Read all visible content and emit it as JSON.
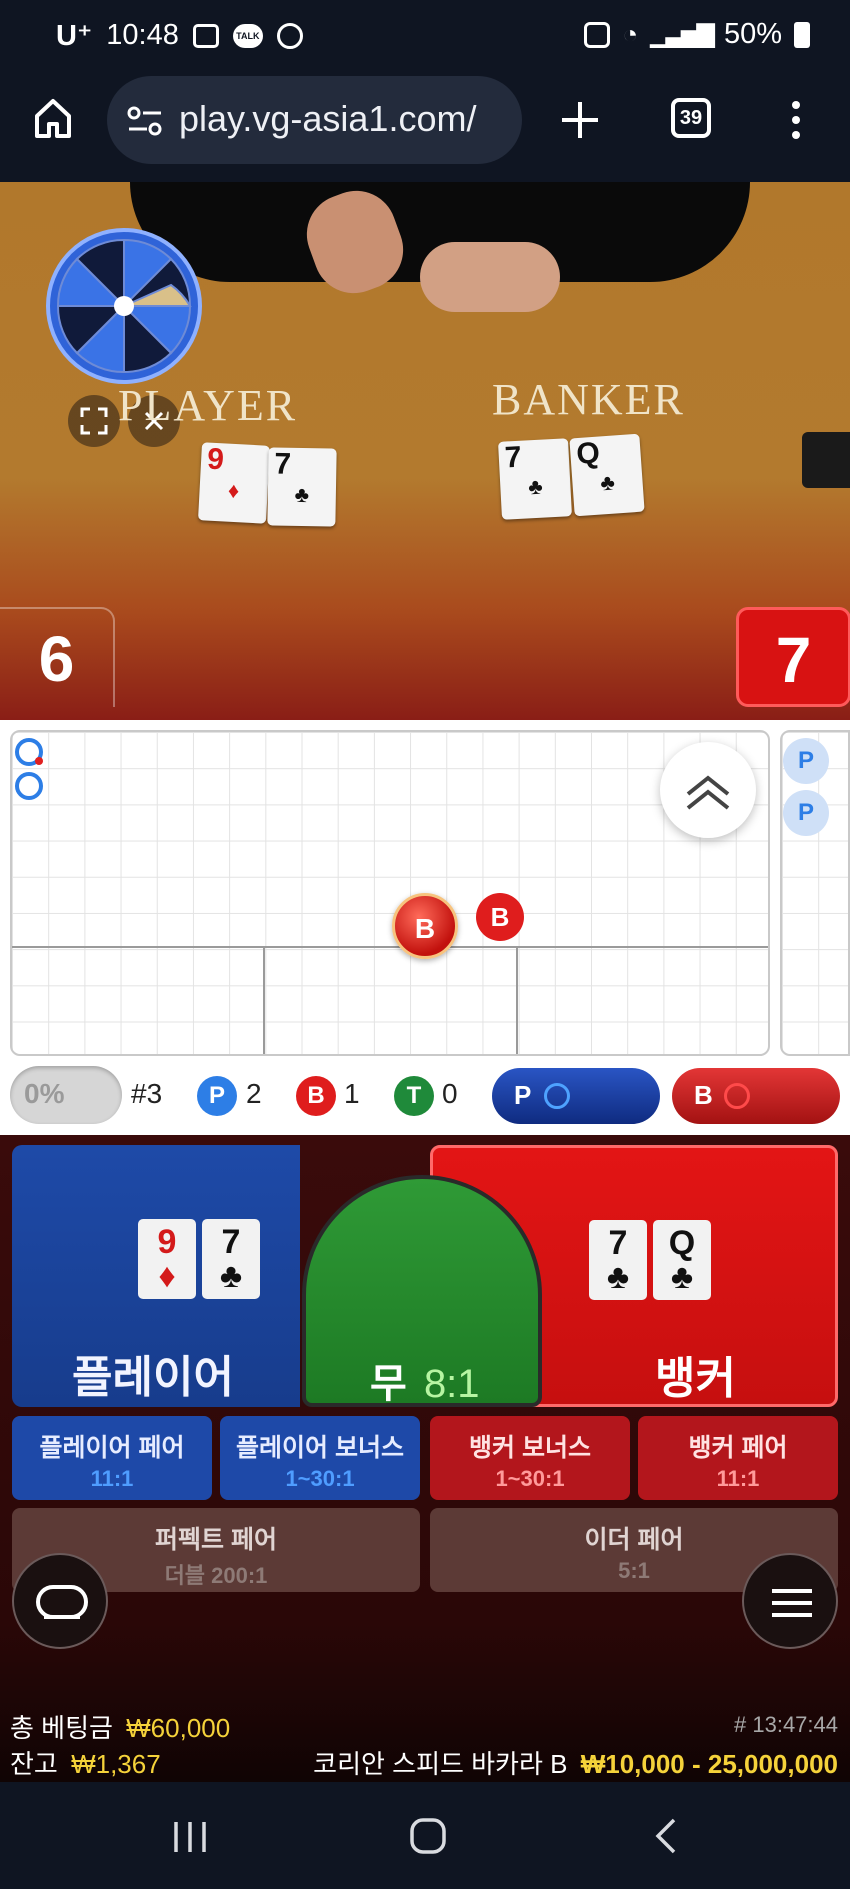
{
  "status_bar": {
    "carrier": "U⁺",
    "time": "10:48",
    "battery": "50%"
  },
  "browser": {
    "url": "play.vg-asia1.com/",
    "tab_count": "39"
  },
  "video": {
    "player_label": "PLAYER",
    "banker_label": "BANKER",
    "player_cards": [
      {
        "rank": "9",
        "suit": "♦",
        "color": "red"
      },
      {
        "rank": "7",
        "suit": "♣",
        "color": "black"
      }
    ],
    "banker_cards": [
      {
        "rank": "7",
        "suit": "♣",
        "color": "black"
      },
      {
        "rank": "Q",
        "suit": "♣",
        "color": "black"
      }
    ],
    "player_score": "6",
    "banker_score": "7"
  },
  "roadmap": {
    "big_ball_label": "B",
    "small_ball_label": "B",
    "side_labels": [
      "P",
      "P"
    ]
  },
  "stats": {
    "percent": "0%",
    "round": "#3",
    "player_badge": "P",
    "player_count": "2",
    "banker_badge": "B",
    "banker_count": "1",
    "tie_badge": "T",
    "tie_count": "0",
    "player_predict": "P",
    "banker_predict": "B"
  },
  "bets": {
    "player": {
      "label": "플레이어",
      "cards": [
        {
          "rank": "9",
          "suit": "♦",
          "color": "red"
        },
        {
          "rank": "7",
          "suit": "♣",
          "color": "black"
        }
      ]
    },
    "tie": {
      "label": "무",
      "odds": "8:1"
    },
    "banker": {
      "label": "뱅커",
      "cards": [
        {
          "rank": "7",
          "suit": "♣",
          "color": "black"
        },
        {
          "rank": "Q",
          "suit": "♣",
          "color": "black"
        }
      ]
    },
    "player_pair": {
      "label": "플레이어 페어",
      "odds": "11:1"
    },
    "player_bonus": {
      "label": "플레이어 보너스",
      "odds": "1~30:1"
    },
    "banker_bonus": {
      "label": "뱅커 보너스",
      "odds": "1~30:1"
    },
    "banker_pair": {
      "label": "뱅커 페어",
      "odds": "11:1"
    },
    "perfect_pair": {
      "label": "퍼펙트 페어",
      "odds": "더블 200:1"
    },
    "either_pair": {
      "label": "이더 페어",
      "odds": "5:1"
    }
  },
  "footer": {
    "total_bet_label": "총 베팅금",
    "total_bet_value": "₩60,000",
    "balance_label": "잔고",
    "balance_value": "₩1,367",
    "game_id": "# 13:47:44",
    "table_name": "코리안 스피드 바카라 B",
    "limits": "₩10,000 - 25,000,000"
  },
  "colors": {
    "player_blue": "#1a3f9a",
    "banker_red": "#d91515",
    "tie_green": "#1f8a2a",
    "gold": "#f5d23a"
  },
  "icons": [
    "home-icon",
    "site-settings-icon",
    "new-tab-icon",
    "tab-switcher-icon",
    "more-icon",
    "fullscreen-icon",
    "close-icon",
    "collapse-icon",
    "chat-icon",
    "menu-icon",
    "recents-icon",
    "nav-home-icon",
    "nav-back-icon"
  ]
}
